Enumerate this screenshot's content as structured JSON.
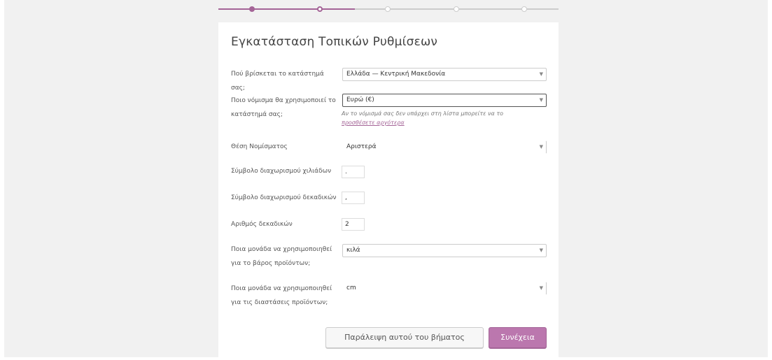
{
  "title": "Εγκατάσταση Τοπικών Ρυθμίσεων",
  "steps": {
    "count": 5,
    "completed": 1,
    "current": 2
  },
  "fields": {
    "country": {
      "label": "Πού βρίσκεται το κατάστημά σας;",
      "value": "Ελλάδα — Κεντρική Μακεδονία"
    },
    "currency": {
      "label": "Ποιο νόμισμα θα χρησιμοποιεί το κατάστημά σας;",
      "value": "Ευρώ (€)",
      "help_text": "Αν το νόμισμά σας δεν υπάρχει στη λίστα μπορείτε να το",
      "help_link": "προσθέσετε αργότερα"
    },
    "currency_position": {
      "label": "Θέση Νομίσματος",
      "value": "Αριστερά"
    },
    "thousand_sep": {
      "label": "Σύμβολο διαχωρισμού χιλιάδων",
      "value": "."
    },
    "decimal_sep": {
      "label": "Σύμβολο διαχωρισμού δεκαδικών",
      "value": ","
    },
    "decimals": {
      "label": "Αριθμός δεκαδικών",
      "value": "2"
    },
    "weight_unit": {
      "label": "Ποια μονάδα να χρησιμοποιηθεί για το βάρος προϊόντων;",
      "value": "κιλά"
    },
    "dimension_unit": {
      "label": "Ποια μονάδα να χρησιμοποιηθεί για τις διαστάσεις προϊόντων;",
      "value": "cm"
    }
  },
  "buttons": {
    "skip": "Παράλειψη αυτού του βήματος",
    "continue": "Συνέχεια"
  }
}
